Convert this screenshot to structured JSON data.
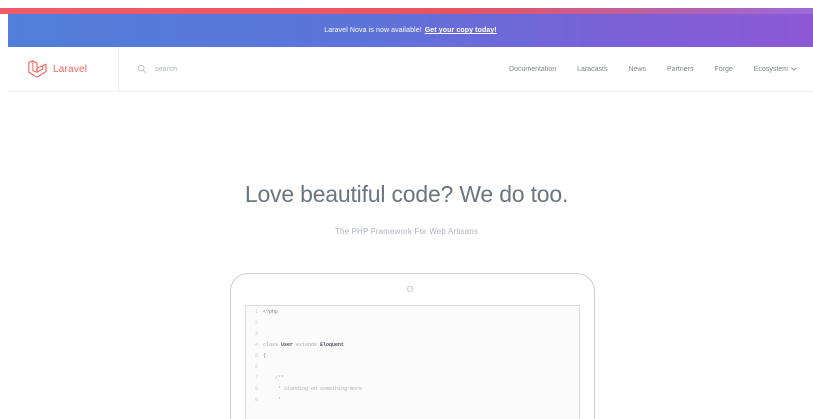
{
  "banner": {
    "message": "Laravel Nova is now available!",
    "cta": "Get your copy today!"
  },
  "brand": {
    "name": "Laravel"
  },
  "search": {
    "placeholder": "search"
  },
  "nav": {
    "links": [
      "Documentation",
      "Laracasts",
      "News",
      "Partners",
      "Forge",
      "Ecosystem"
    ]
  },
  "hero": {
    "title": "Love beautiful code? We do too.",
    "subtitle": "The PHP Framework For Web Artisans"
  },
  "code": {
    "lines": [
      {
        "num": "1",
        "text": "<?php"
      },
      {
        "num": "2",
        "text": ""
      },
      {
        "num": "3",
        "text": ""
      },
      {
        "num": "4",
        "prefix": "class ",
        "name": "User",
        "middle": " extends ",
        "parent": "Eloquent"
      },
      {
        "num": "5",
        "text": "{"
      },
      {
        "num": "6",
        "text": ""
      },
      {
        "num": "7",
        "text": "    /**"
      },
      {
        "num": "8",
        "text": "     * Standing on something more"
      },
      {
        "num": "9",
        "text": "     *"
      }
    ]
  },
  "icons": {
    "brand": "laravel-logo-icon",
    "search": "search-icon",
    "ecosystem_caret": "caret-down-icon",
    "camera": "camera-icon"
  },
  "colors": {
    "brand_red": "#f4645f",
    "banner_start": "#4f7fd8",
    "banner_end": "#8d57d6",
    "text_gray": "#6c757d"
  }
}
